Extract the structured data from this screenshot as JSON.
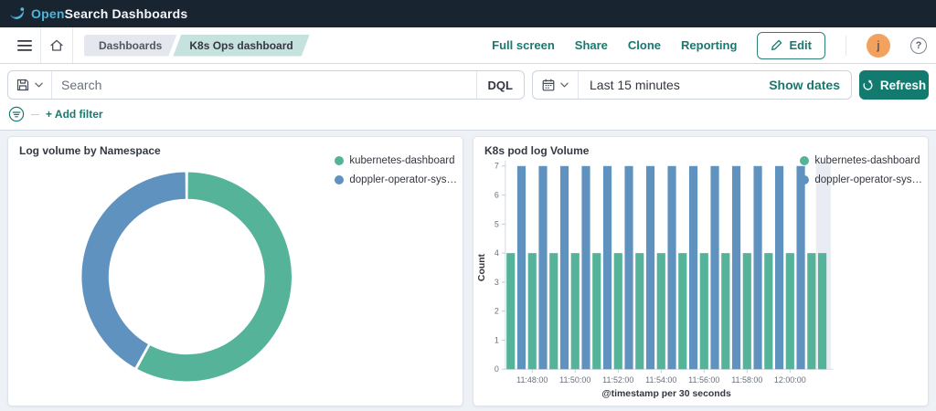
{
  "navbar": {
    "brand_open": "Open",
    "brand_search": "Search",
    "brand_product": "Dashboards"
  },
  "toolbar": {
    "breadcrumbs": {
      "first": "Dashboards",
      "current": "K8s Ops dashboard"
    },
    "actions": {
      "full_screen": "Full screen",
      "share": "Share",
      "clone": "Clone",
      "reporting": "Reporting"
    },
    "edit_label": "Edit",
    "avatar_initial": "j",
    "help_glyph": "?"
  },
  "search_bar": {
    "placeholder": "Search",
    "query_language": "DQL",
    "time_range": "Last 15 minutes",
    "show_dates": "Show dates",
    "refresh": "Refresh"
  },
  "filter_bar": {
    "add_filter": "+ Add filter"
  },
  "icons": [
    "opensearch-logo",
    "hamburger-menu-icon",
    "home-icon",
    "save-query-icon",
    "chevron-down-icon",
    "calendar-icon",
    "refresh-icon",
    "filter-icon",
    "pencil-icon",
    "question-mark-icon"
  ],
  "colors": {
    "series_green": "#54B399",
    "series_blue": "#6092C0",
    "primary_teal": "#137a6f",
    "navbar_bg": "#182430",
    "avatar_orange": "#f2a15f",
    "incomplete_bucket_band": "#e9edf3"
  },
  "chart_data": [
    {
      "type": "pie",
      "donut": true,
      "title": "Log volume by Namespace",
      "labels": [
        "kubernetes-dashboard",
        "doppler-operator-sys…"
      ],
      "values": [
        0.58,
        0.42
      ],
      "colors": [
        "#54B399",
        "#6092C0"
      ],
      "start_angle_deg": -90,
      "legend_position": "top-right"
    },
    {
      "type": "bar",
      "title": "K8s pod log Volume",
      "xlabel": "@timestamp per 30 seconds",
      "ylabel": "Count",
      "ylim": [
        0,
        7
      ],
      "yticks": [
        0,
        1,
        2,
        3,
        4,
        5,
        6,
        7
      ],
      "categories": [
        "11:47:00",
        "11:47:30",
        "11:48:00",
        "11:48:30",
        "11:49:00",
        "11:49:30",
        "11:50:00",
        "11:50:30",
        "11:51:00",
        "11:51:30",
        "11:52:00",
        "11:52:30",
        "11:53:00",
        "11:53:30",
        "11:54:00",
        "11:54:30",
        "11:55:00",
        "11:55:30",
        "11:56:00",
        "11:56:30",
        "11:57:00",
        "11:57:30",
        "11:58:00",
        "11:58:30",
        "11:59:00",
        "11:59:30",
        "12:00:00",
        "12:00:30",
        "12:01:00",
        "12:01:30"
      ],
      "xtick_labels": [
        "11:48:00",
        "11:50:00",
        "11:52:00",
        "11:54:00",
        "11:56:00",
        "11:58:00",
        "12:00:00"
      ],
      "series": [
        {
          "name": "kubernetes-dashboard",
          "color": "#54B399",
          "values": [
            4,
            null,
            4,
            null,
            4,
            null,
            4,
            null,
            4,
            null,
            4,
            null,
            4,
            null,
            4,
            null,
            4,
            null,
            4,
            null,
            4,
            null,
            4,
            null,
            4,
            null,
            4,
            null,
            4,
            4
          ]
        },
        {
          "name": "doppler-operator-sys…",
          "color": "#6092C0",
          "values": [
            null,
            7,
            null,
            7,
            null,
            7,
            null,
            7,
            null,
            7,
            null,
            7,
            null,
            7,
            null,
            7,
            null,
            7,
            null,
            7,
            null,
            7,
            null,
            7,
            null,
            7,
            null,
            7,
            null,
            null
          ]
        }
      ],
      "grid": false,
      "legend_position": "top-right",
      "incomplete_bucket_shaded": true
    }
  ]
}
